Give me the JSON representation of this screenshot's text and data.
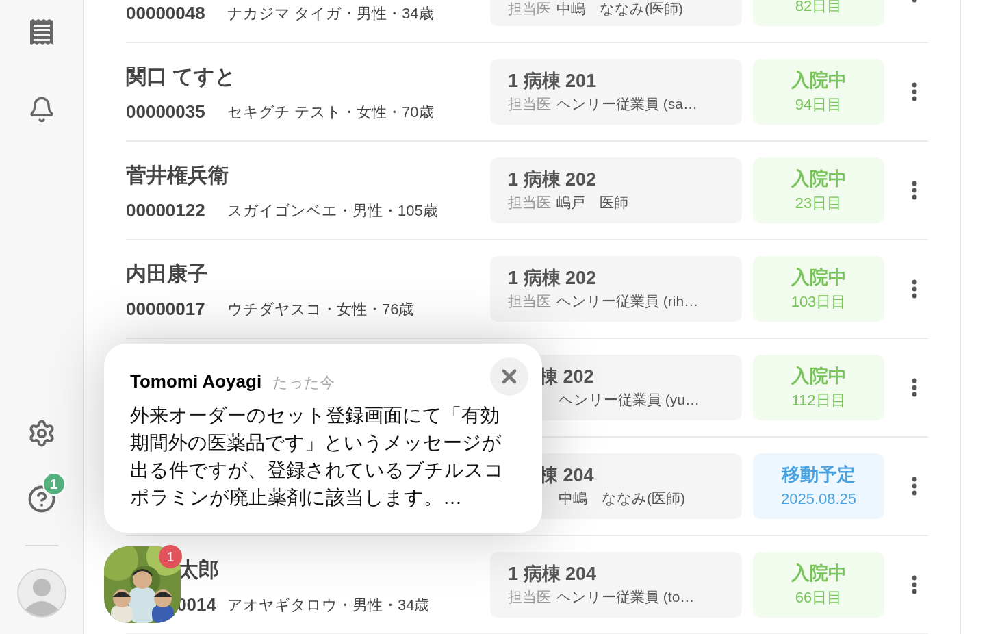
{
  "sidebar": {
    "help_badge": "1"
  },
  "patients": [
    {
      "kind": "cut_top",
      "id": "00000048",
      "info": "ナカジマ タイガ・男性・34歳",
      "doctor_label": "担当医",
      "doctor": "中嶋　ななみ(医師)",
      "status": {
        "kind": "admitted",
        "days": "82日目"
      }
    },
    {
      "kind": "full",
      "name": "関口 てすと",
      "id": "00000035",
      "info": "セキグチ テスト・女性・70歳",
      "ward": "1 病棟 201",
      "doctor_label": "担当医",
      "doctor": "ヘンリー従業員 (sa…",
      "status": {
        "kind": "admitted",
        "label": "入院中",
        "days": "94日目"
      }
    },
    {
      "kind": "full",
      "name": "菅井権兵衛",
      "id": "00000122",
      "info": "スガイゴンベエ・男性・105歳",
      "ward": "1 病棟 202",
      "doctor_label": "担当医",
      "doctor": "嶋戸　医師",
      "status": {
        "kind": "admitted",
        "label": "入院中",
        "days": "23日目"
      }
    },
    {
      "kind": "full",
      "name": "内田康子",
      "id": "00000017",
      "info": "ウチダヤスコ・女性・76歳",
      "ward": "1 病棟 202",
      "doctor_label": "担当医",
      "doctor": "ヘンリー従業員 (rih…",
      "status": {
        "kind": "admitted",
        "label": "入院中",
        "days": "103日目"
      }
    },
    {
      "kind": "popup_covered",
      "ward": "棟 202",
      "doctor": "ヘンリー従業員 (yu…",
      "status": {
        "kind": "admitted",
        "label": "入院中",
        "days": "112日目"
      }
    },
    {
      "kind": "popup_covered",
      "ward": "棟 204",
      "doctor": "中嶋　ななみ(医師)",
      "status": {
        "kind": "scheduled",
        "label": "移動予定",
        "days": "2025.08.25"
      }
    },
    {
      "kind": "avatar_covered",
      "name": "太郎",
      "id": "0014",
      "info": "アオヤギタロウ・男性・34歳",
      "ward": "1 病棟 204",
      "doctor_label": "担当医",
      "doctor": "ヘンリー従業員 (to…",
      "status": {
        "kind": "admitted",
        "label": "入院中",
        "days": "66日目"
      }
    }
  ],
  "notification": {
    "sender": "Tomomi Aoyagi",
    "time": "たった今",
    "message": "外来オーダーのセット登録画面にて「有効期間外の医薬品です」というメッセージが出る件ですが、登録されているブチルスコポラミンが廃止薬剤に該当します。…",
    "avatar_badge": "1"
  }
}
